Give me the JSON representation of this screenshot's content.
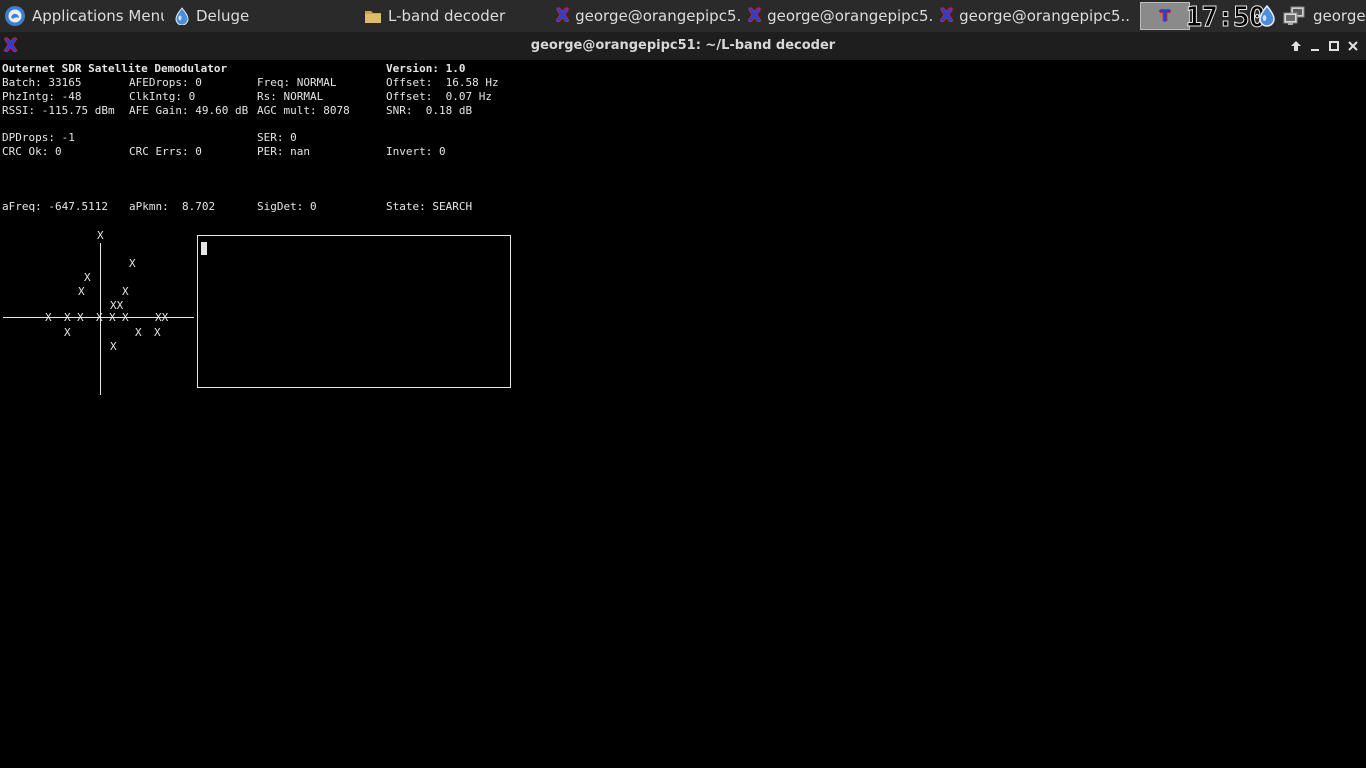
{
  "panel": {
    "apps_menu_label": "Applications Menu",
    "tasks": [
      {
        "label": "Deluge"
      },
      {
        "label": "L-band decoder"
      },
      {
        "label": "george@orangepipc5..."
      },
      {
        "label": "george@orangepipc5..."
      },
      {
        "label": "george@orangepipc5..."
      }
    ],
    "clock": "17:50",
    "user": "george"
  },
  "window": {
    "title": "george@orangepipc51: ~/L-band decoder"
  },
  "term": {
    "title": "Outernet SDR Satellite Demodulator",
    "version": "Version: 1.0",
    "batch": "Batch: 33165",
    "afedrops": "AFEDrops: 0",
    "freq": "Freq: NORMAL",
    "offset_hz": "Offset:  16.58 Hz",
    "phzintg": "PhzIntg: -48",
    "clkintg": "ClkIntg: 0",
    "rs": "Rs: NORMAL",
    "offset2": "Offset:  0.07 Hz",
    "rssi": "RSSI: -115.75 dBm",
    "afegain": "AFE Gain: 49.60 dB",
    "agcmult": "AGC mult: 8078",
    "snr": "SNR:  0.18 dB",
    "dpdrops": "DPDrops: -1",
    "ser": "SER: 0",
    "crcok": "CRC Ok: 0",
    "crcerrs": "CRC Errs: 0",
    "per": "PER: nan",
    "invert": "Invert: 0",
    "afreq": "aFreq: -647.5112",
    "apkmn": "aPkmn:  8.702",
    "sigdet": "SigDet: 0",
    "state": "State: SEARCH",
    "constellation_mark": "X",
    "axis_marks": "X",
    "double_mark": "XX"
  }
}
